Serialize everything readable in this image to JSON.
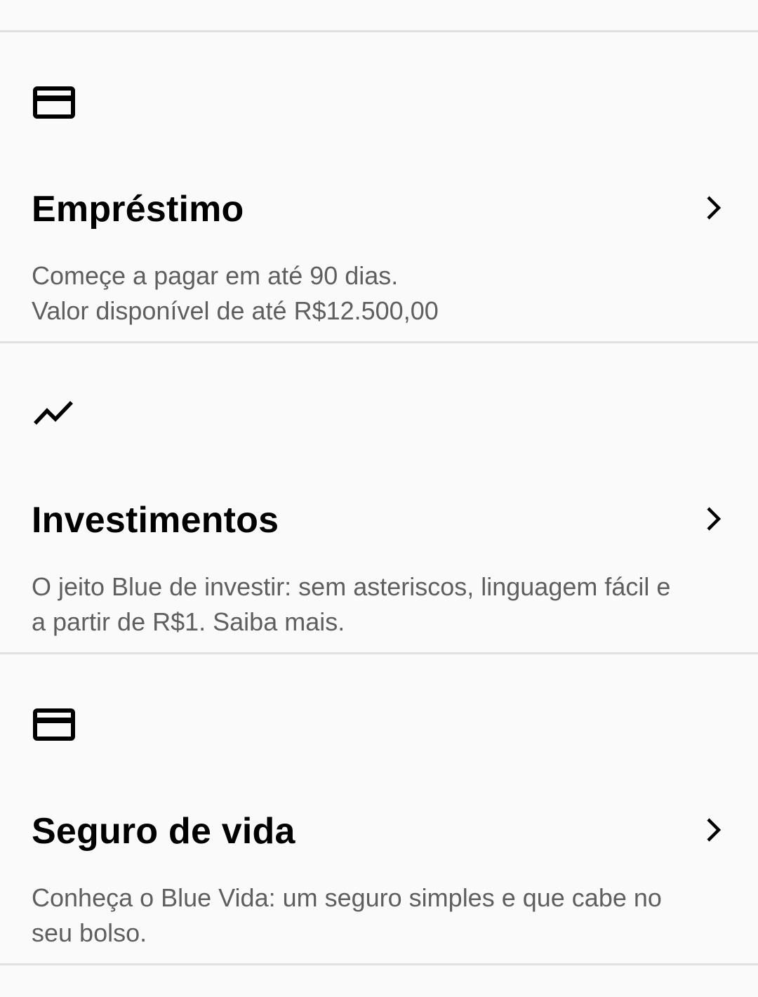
{
  "products": [
    {
      "icon": "credit-card-icon",
      "title": "Empréstimo",
      "description_lines": [
        "Começe a pagar em até 90 dias.",
        "Valor disponível de até R$12.500,00"
      ]
    },
    {
      "icon": "trending-up-icon",
      "title": "Investimentos",
      "description_lines": [
        "O jeito Blue de investir: sem asteriscos, linguagem fácil e",
        "a partir de R$1. Saiba mais."
      ]
    },
    {
      "icon": "credit-card-icon",
      "title": "Seguro de vida",
      "description_lines": [
        "Conheça o Blue Vida: um seguro simples e que cabe no",
        "seu bolso."
      ]
    }
  ],
  "colors": {
    "background": "#fafafa",
    "divider": "#e0e0e0",
    "title": "#000000",
    "description": "#5f5f5f"
  }
}
